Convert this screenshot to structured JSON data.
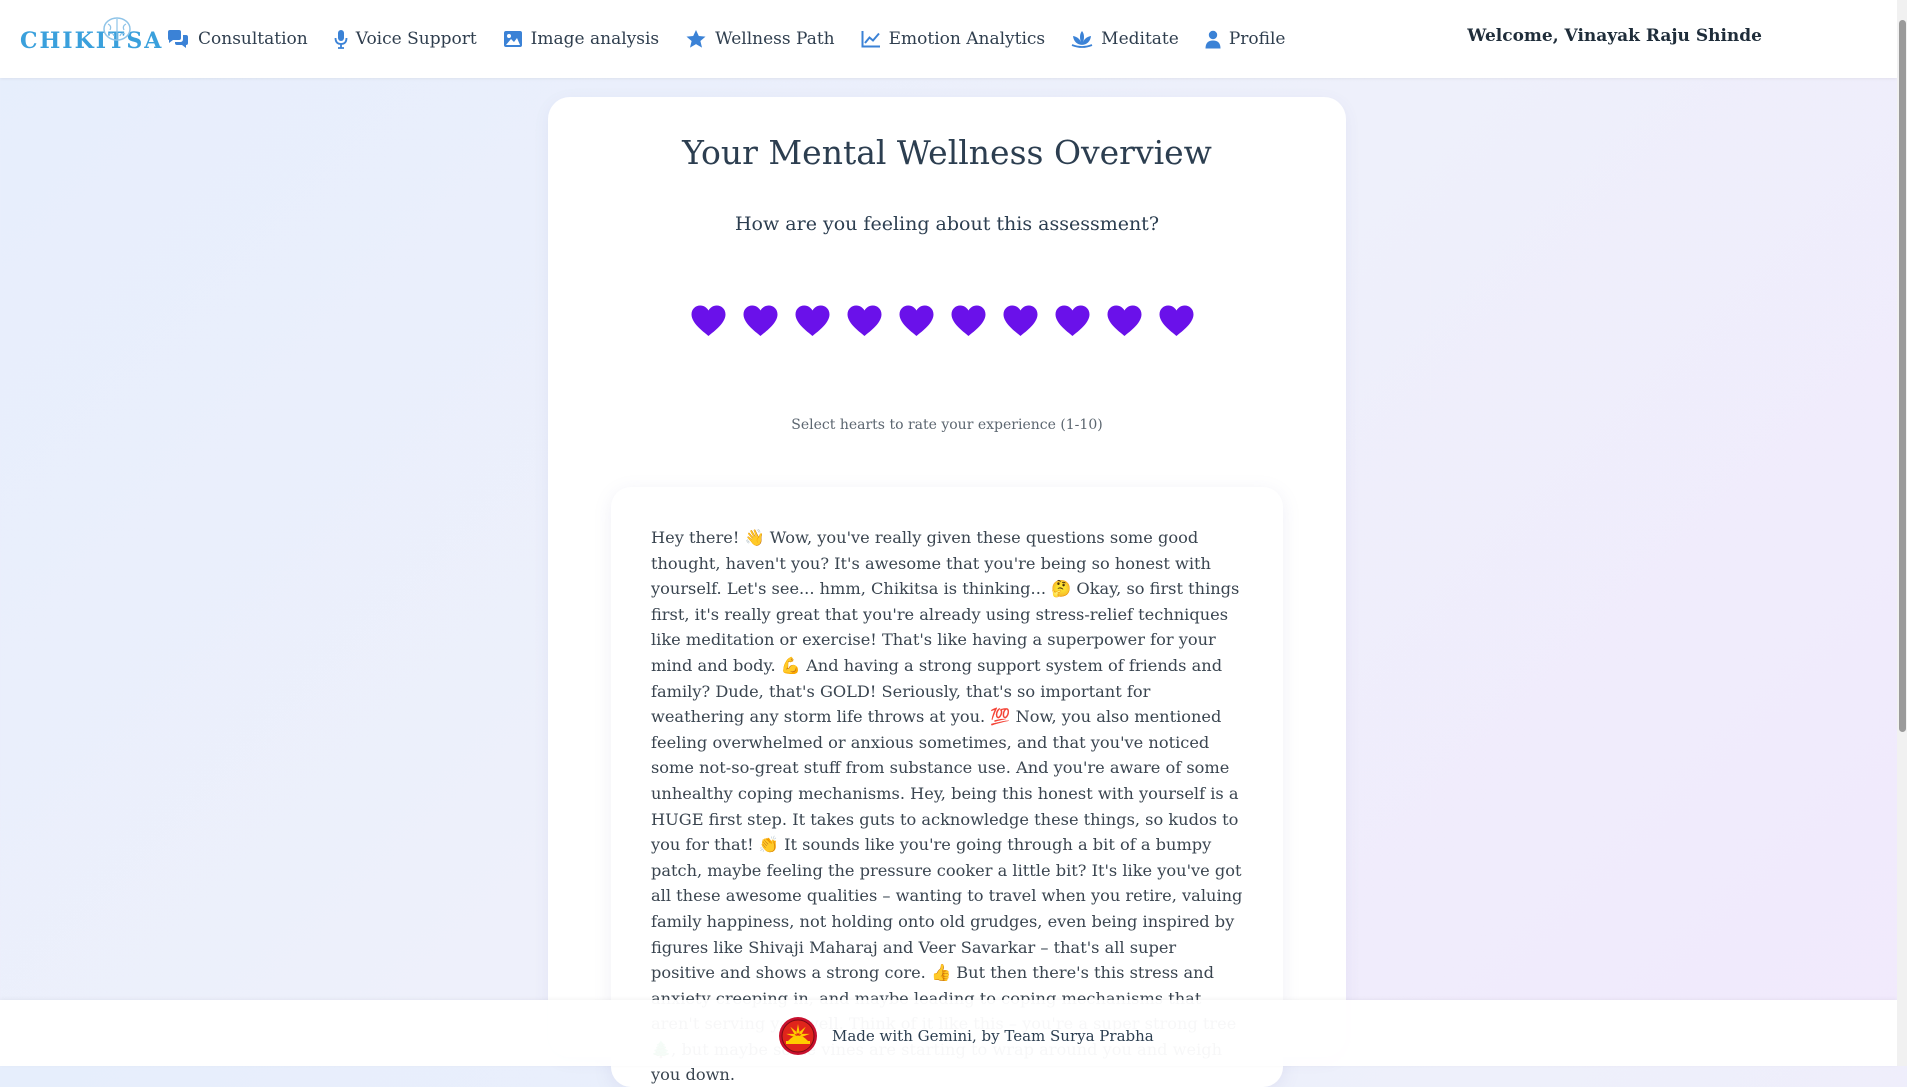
{
  "brand": {
    "name": "CHIKITSA"
  },
  "nav": {
    "items": [
      {
        "label": "Consultation",
        "icon": "chat-bubbles-icon"
      },
      {
        "label": "Voice Support",
        "icon": "microphone-icon"
      },
      {
        "label": "Image analysis",
        "icon": "image-icon"
      },
      {
        "label": "Wellness Path",
        "icon": "star-icon"
      },
      {
        "label": "Emotion Analytics",
        "icon": "line-chart-icon"
      },
      {
        "label": "Meditate",
        "icon": "lotus-icon"
      },
      {
        "label": "Profile",
        "icon": "user-icon"
      }
    ],
    "welcome": "Welcome, Vinayak Raju Shinde"
  },
  "overview": {
    "title": "Your Mental Wellness Overview",
    "question": "How are you feeling about this assessment?",
    "rating": {
      "selected": 10,
      "max": 10,
      "heart_color": "#6a11ea"
    },
    "hint": "Select hearts to rate your experience (1-10)"
  },
  "response": {
    "text": "Hey there! 👋 Wow, you've really given these questions some good thought, haven't you? It's awesome that you're being so honest with yourself. Let's see... hmm, Chikitsa is thinking... 🤔 Okay, so first things first, it's really great that you're already using stress-relief techniques like meditation or exercise! That's like having a superpower for your mind and body. 💪 And having a strong support system of friends and family? Dude, that's GOLD! Seriously, that's so important for weathering any storm life throws at you. 💯 Now, you also mentioned feeling overwhelmed or anxious sometimes, and that you've noticed some not-so-great stuff from substance use. And you're aware of some unhealthy coping mechanisms. Hey, being this honest with yourself is a HUGE first step. It takes guts to acknowledge these things, so kudos to you for that! 👏 It sounds like you're going through a bit of a bumpy patch, maybe feeling the pressure cooker a little bit? It's like you've got all these awesome qualities – wanting to travel when you retire, valuing family happiness, not holding onto old grudges, even being inspired by figures like Shivaji Maharaj and Veer Savarkar – that's all super positive and shows a strong core. 👍 But then there's this stress and anxiety creeping in, and maybe leading to coping mechanisms that aren't serving you well. Think of it like this – you're a super strong tree 🌲, but maybe some vines are starting to wrap around you and weigh you down."
  },
  "footer": {
    "text": "Made with Gemini, by Team Surya Prabha"
  },
  "colors": {
    "accent": "#3b82d6",
    "heart": "#6a11ea",
    "text": "#2c3e50"
  }
}
